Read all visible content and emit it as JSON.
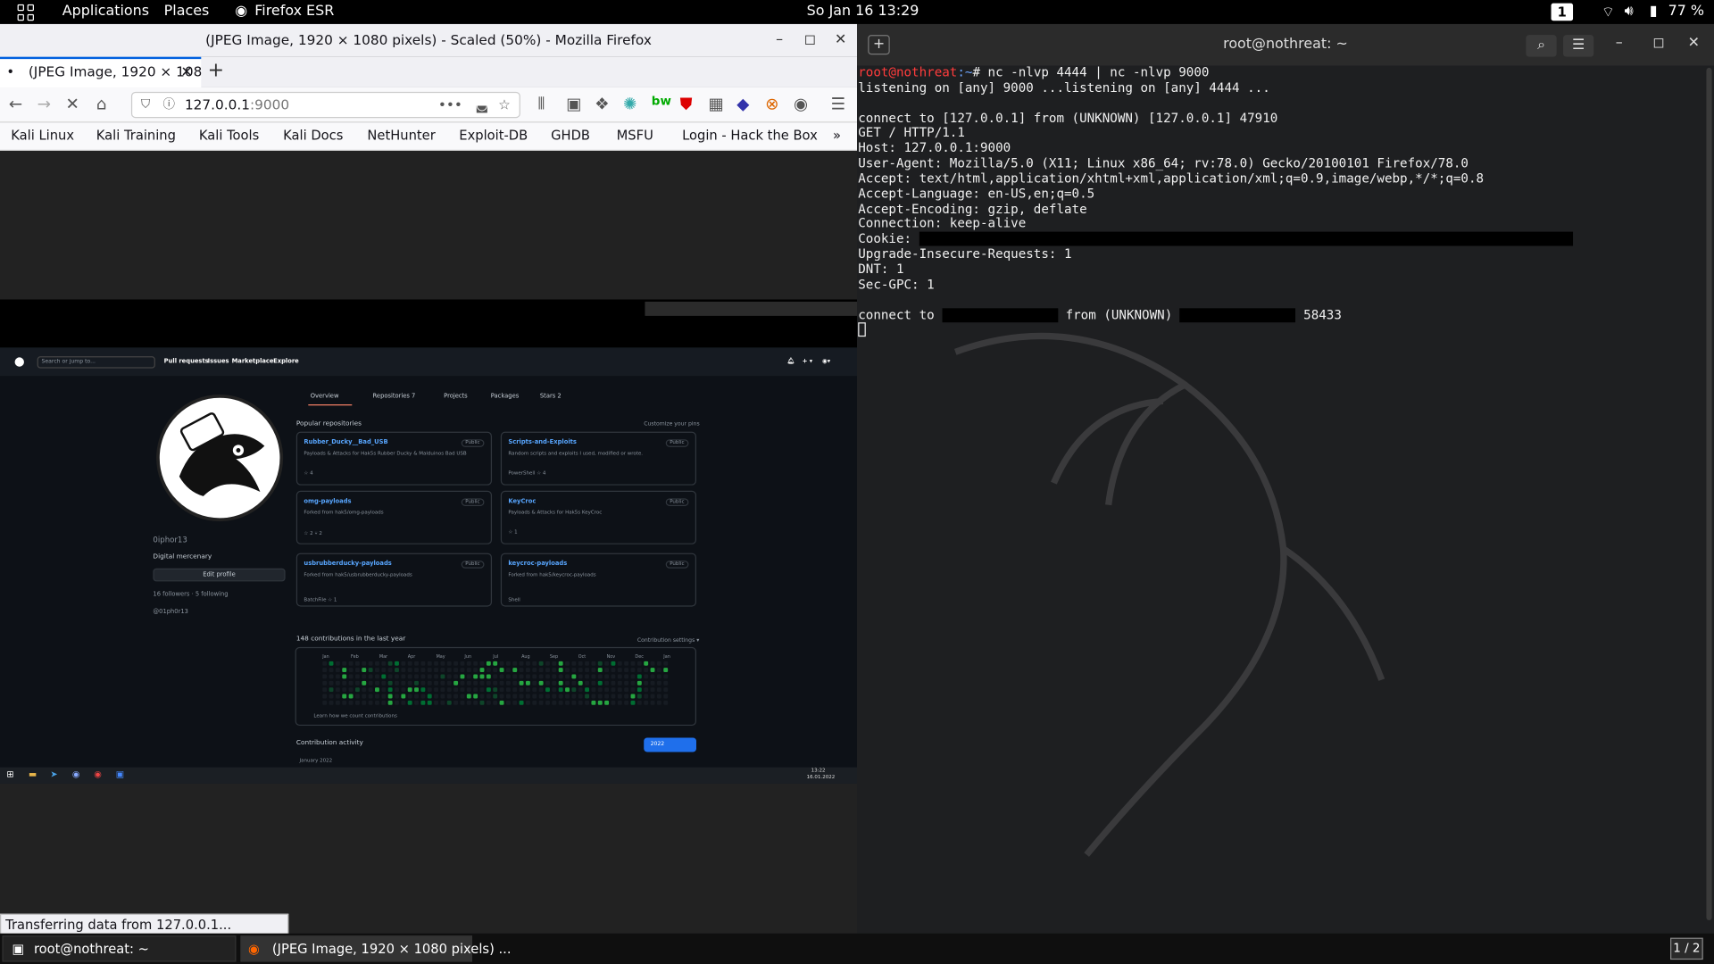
{
  "topbar": {
    "applications": "Applications",
    "places": "Places",
    "app": "Firefox ESR",
    "datetime": "So Jan 16  13:29",
    "workspace": "1",
    "battery": "77 %"
  },
  "firefox": {
    "window_title": "(JPEG Image, 1920 × 1080 pixels) - Scaled (50%) - Mozilla Firefox",
    "tab_title": "(JPEG Image, 1920 × 108",
    "url_host": "127.0.0.1",
    "url_port": ":9000",
    "bookmarks": [
      "Kali Linux",
      "Kali Training",
      "Kali Tools",
      "Kali Docs",
      "NetHunter",
      "Exploit-DB",
      "GHDB",
      "MSFU",
      "Login - Hack the Box"
    ],
    "status": "Transferring data from 127.0.0.1..."
  },
  "github": {
    "search": "Search or jump to...",
    "nav": [
      "Pull requests",
      "Issues",
      "Marketplace",
      "Explore"
    ],
    "tabs": [
      "Overview",
      "Repositories 7",
      "Projects",
      "Packages",
      "Stars 2"
    ],
    "username": "0iphor13",
    "bio": "Digital mercenary",
    "edit_profile": "Edit profile",
    "followers": "16 followers · 5 following",
    "twitter": "@01ph0r13",
    "popular_title": "Popular repositories",
    "customize": "Customize your pins",
    "repos": [
      {
        "name": "Rubber_Ducky__Bad_USB",
        "desc": "Payloads & Attacks for Hak5s Rubber Ducky & Malduinos Bad USB",
        "meta": "☆ 4"
      },
      {
        "name": "Scripts-and-Exploits",
        "desc": "Random scripts and exploits I used, modified or wrote.",
        "meta": "PowerShell  ☆ 4"
      },
      {
        "name": "omg-payloads",
        "desc": "Forked from hak5/omg-payloads",
        "meta": "☆ 2   ⑂ 2"
      },
      {
        "name": "KeyCroc",
        "desc": "Payloads & Attacks for Hak5s KeyCroc",
        "meta": "☆ 1"
      },
      {
        "name": "usbrubberducky-payloads",
        "desc": "Forked from hak5/usbrubberducky-payloads",
        "meta": "BatchFile  ☆ 1"
      },
      {
        "name": "keycroc-payloads",
        "desc": "Forked from hak5/keycroc-payloads",
        "meta": "Shell"
      }
    ],
    "public": "Public",
    "contrib_title": "148 contributions in the last year",
    "contrib_settings": "Contribution settings ▾",
    "activity": "Contribution activity",
    "year": "2022",
    "month": "January 2022",
    "months": [
      "Jan",
      "Feb",
      "Mar",
      "Apr",
      "May",
      "Jun",
      "Jul",
      "Aug",
      "Sep",
      "Oct",
      "Nov",
      "Dec",
      "Jan"
    ],
    "learn": "Learn how we count contributions",
    "clock": "13:22",
    "date": "16.01.2022"
  },
  "terminal": {
    "title": "root@nothreat: ~",
    "prompt_user": "root@nothreat",
    "prompt_path": ":~",
    "command": "# nc -nlvp 4444 | nc -nlvp 9000",
    "lines": [
      "listening on [any] 9000 ...listening on [any] 4444 ...",
      "",
      "connect to [127.0.0.1] from (UNKNOWN) [127.0.0.1] 47910",
      "GET / HTTP/1.1",
      "Host: 127.0.0.1:9000",
      "User-Agent: Mozilla/5.0 (X11; Linux x86_64; rv:78.0) Gecko/20100101 Firefox/78.0",
      "Accept: text/html,application/xhtml+xml,application/xml;q=0.9,image/webp,*/*;q=0.8",
      "Accept-Language: en-US,en;q=0.5",
      "Accept-Encoding: gzip, deflate",
      "Connection: keep-alive"
    ],
    "cookie_label": "Cookie: ",
    "lines2": [
      "Upgrade-Insecure-Requests: 1",
      "DNT: 1",
      "Sec-GPC: 1",
      ""
    ],
    "connect_a": "connect to ",
    "connect_b": " from (UNKNOWN) ",
    "connect_port": " 58433"
  },
  "taskbar": {
    "terminal": "root@nothreat: ~",
    "firefox": "(JPEG Image, 1920 × 1080 pixels) ...",
    "pager": "1 / 2"
  }
}
